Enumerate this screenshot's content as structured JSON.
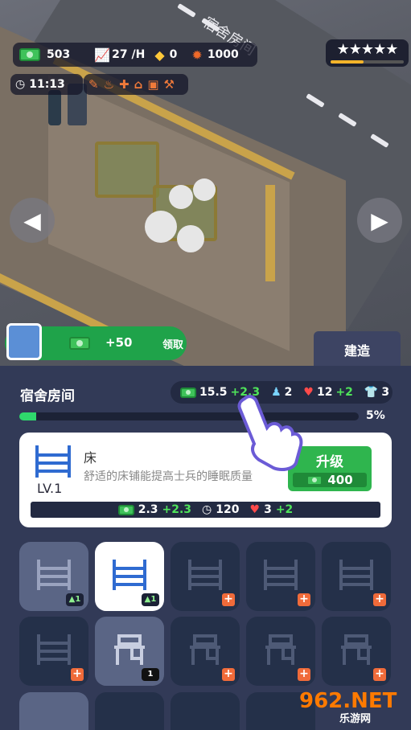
{
  "hud": {
    "money": "503",
    "income_rate": "27 /H",
    "gems": "0",
    "gears": "1000",
    "time": "11:13",
    "rating_stars": "★★★★★",
    "rating_progress": 0.45
  },
  "scene": {
    "street_label": "宿舍房间"
  },
  "reward": {
    "amount": "+50",
    "claim_label": "领取"
  },
  "build_tab_label": "建造",
  "room": {
    "title": "宿舍房间",
    "income": "15.5",
    "income_plus": "+2.3",
    "capacity": "2",
    "health": "12",
    "health_plus": "+2",
    "uniforms": "3",
    "progress_pct": "5%",
    "progress_value": 0.05
  },
  "item_card": {
    "name": "床",
    "level": "LV.1",
    "description": "舒适的床铺能提高士兵的睡眠质量",
    "upgrade_label": "升级",
    "upgrade_cost": "400",
    "stat_income": "2.3",
    "stat_income_plus": "+2.3",
    "stat_time": "120",
    "stat_health": "3",
    "stat_health_plus": "+2"
  },
  "grid": [
    {
      "type": "bed",
      "state": "unlocked",
      "badge": "▲1"
    },
    {
      "type": "bed",
      "state": "selected",
      "badge": "▲1"
    },
    {
      "type": "bed",
      "state": "locked",
      "badge": "+"
    },
    {
      "type": "bed",
      "state": "locked",
      "badge": "+"
    },
    {
      "type": "bed",
      "state": "locked",
      "badge": "+"
    },
    {
      "type": "bed",
      "state": "locked",
      "badge": "+"
    },
    {
      "type": "desk",
      "state": "unlocked",
      "badge": "1"
    },
    {
      "type": "desk",
      "state": "locked",
      "badge": "+"
    },
    {
      "type": "desk",
      "state": "locked",
      "badge": "+"
    },
    {
      "type": "desk",
      "state": "locked",
      "badge": "+"
    }
  ],
  "watermark": "962.NET",
  "watermark_sub": "乐游网",
  "colors": {
    "panel": "#323a57",
    "accent_green": "#2fb54e",
    "plus_green": "#4fe35a",
    "star_gold": "#f4b42a"
  }
}
